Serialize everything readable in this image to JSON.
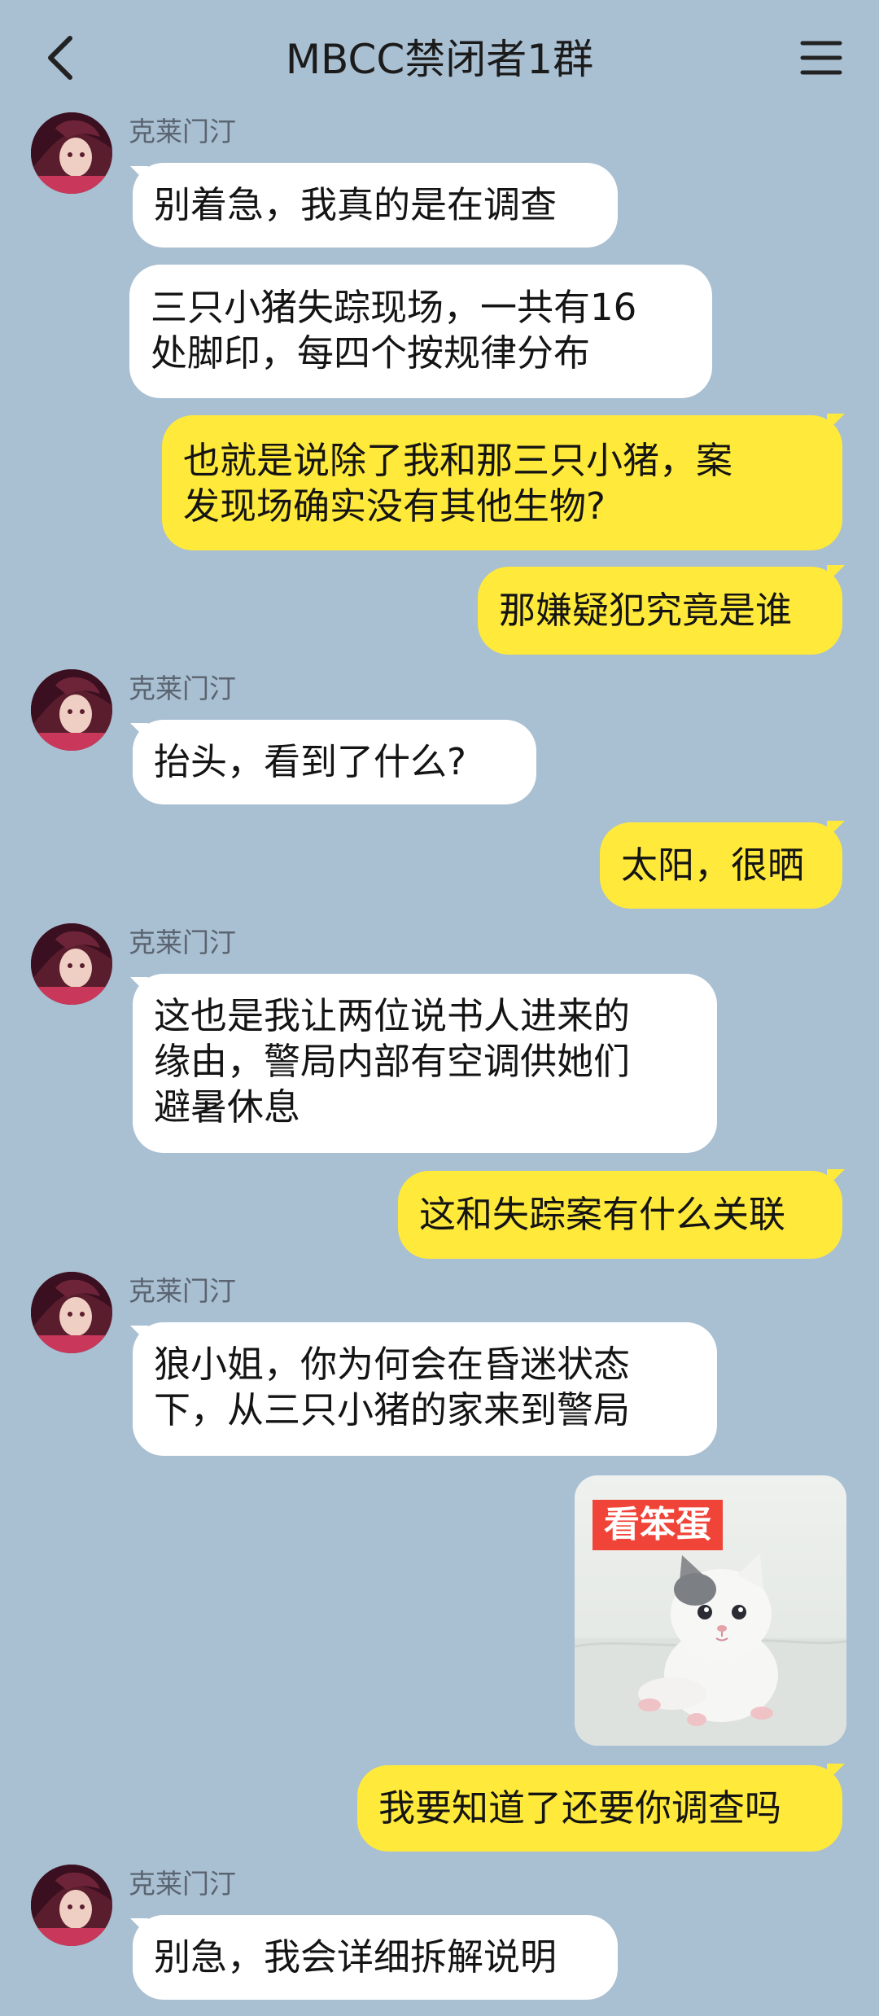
{
  "header": {
    "title": "MBCC禁闭者1群"
  },
  "messages": [
    {
      "sender": "克莱门汀",
      "text": "别着急，我真的是在调查"
    },
    {
      "text": "三只小猪失踪现场，一共有16\n处脚印，每四个按规律分布"
    },
    {
      "text": "也就是说除了我和那三只小猪，案\n发现场确实没有其他生物?"
    },
    {
      "text": "那嫌疑犯究竟是谁"
    },
    {
      "sender": "克莱门汀",
      "text": "抬头，看到了什么?"
    },
    {
      "text": "太阳，很晒"
    },
    {
      "sender": "克莱门汀",
      "text": "这也是我让两位说书人进来的\n缘由，警局内部有空调供她们\n避暑休息"
    },
    {
      "text": "这和失踪案有什么关联"
    },
    {
      "sender": "克莱门汀",
      "text": "狼小姐，你为何会在昏迷状态\n下，从三只小猪的家来到警局"
    },
    {
      "image_caption": "看笨蛋"
    },
    {
      "text": "我要知道了还要你调查吗"
    },
    {
      "sender": "克莱门汀",
      "text": "别急，我会详细拆解说明"
    }
  ],
  "colors": {
    "background": "#a9bfd2",
    "incoming_bubble": "#ffffff",
    "outgoing_bubble": "#ffe93a"
  }
}
